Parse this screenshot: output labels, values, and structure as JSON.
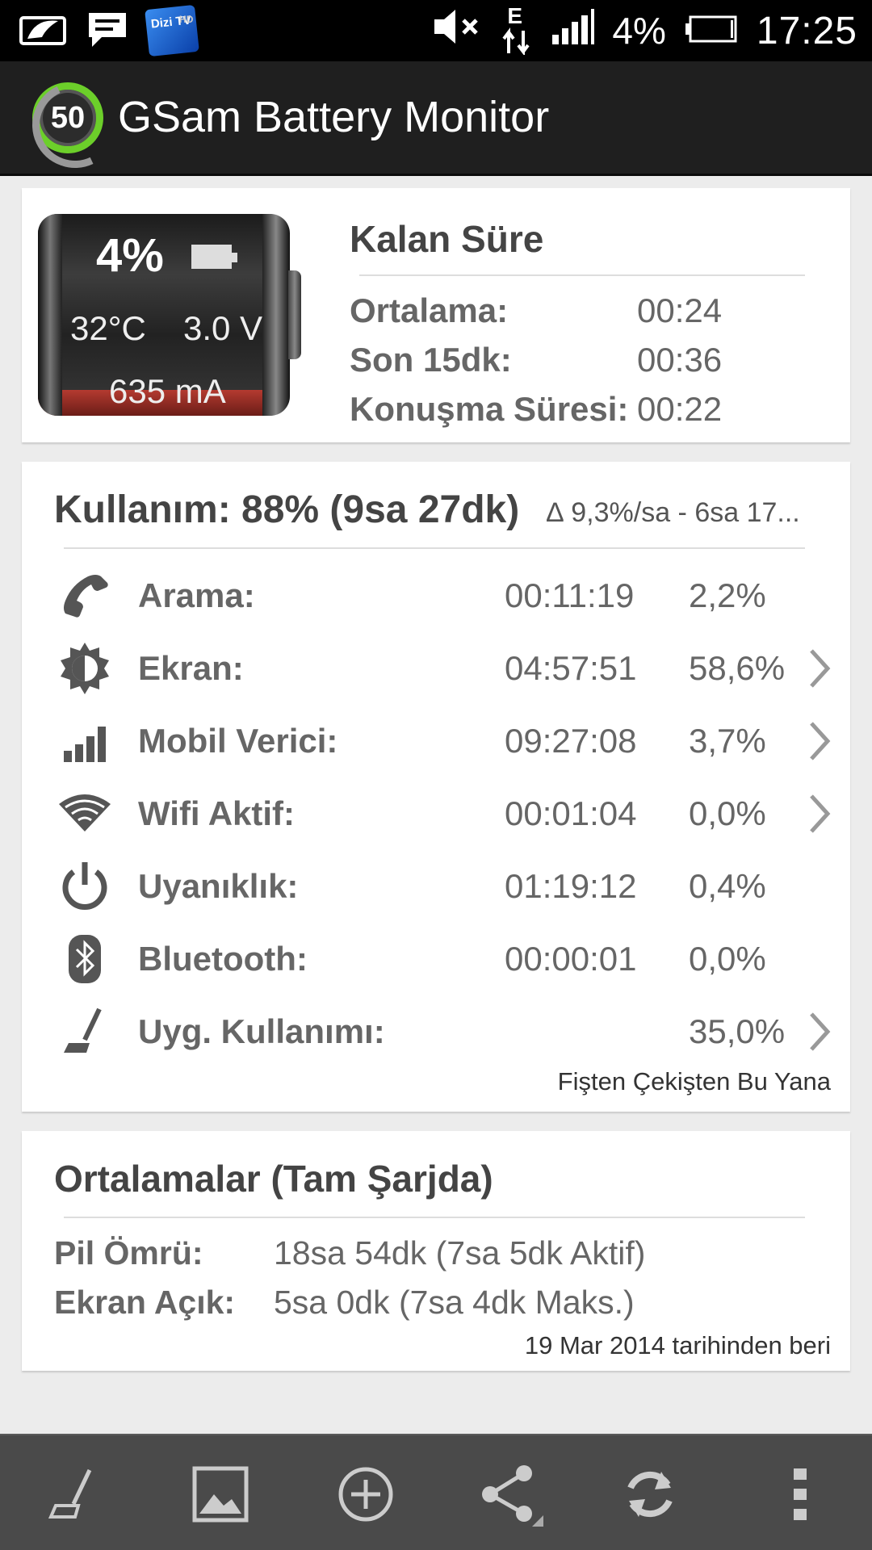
{
  "status_bar": {
    "battery_percent": "4%",
    "time": "17:25",
    "network_type": "E",
    "tv_app": "Dizi TV",
    "tv_hd": "HD"
  },
  "app": {
    "title": "GSam Battery Monitor",
    "logo_value": "50"
  },
  "battery": {
    "percent": "4%",
    "temperature": "32°C",
    "voltage": "3.0 V",
    "current": "635 mA",
    "level_fraction": 0.04
  },
  "remaining": {
    "title": "Kalan Süre",
    "rows": [
      {
        "label": "Ortalama:",
        "value": "00:24"
      },
      {
        "label": "Son 15dk:",
        "value": "00:36"
      },
      {
        "label": "Konuşma Süresi:",
        "value": "00:22"
      }
    ]
  },
  "usage": {
    "title": "Kullanım: 88% (9sa 27dk)",
    "delta": "∆ 9,3%/sa - 6sa 17...",
    "rows": [
      {
        "icon": "phone-icon",
        "label": "Arama:",
        "time": "00:11:19",
        "percent": "2,2%",
        "has_chevron": false
      },
      {
        "icon": "brightness-icon",
        "label": "Ekran:",
        "time": "04:57:51",
        "percent": "58,6%",
        "has_chevron": true
      },
      {
        "icon": "signal-bars-icon",
        "label": "Mobil Verici:",
        "time": "09:27:08",
        "percent": "3,7%",
        "has_chevron": true
      },
      {
        "icon": "wifi-icon",
        "label": "Wifi Aktif:",
        "time": "00:01:04",
        "percent": "0,0%",
        "has_chevron": true
      },
      {
        "icon": "power-icon",
        "label": "Uyanıklık:",
        "time": "01:19:12",
        "percent": "0,4%",
        "has_chevron": false
      },
      {
        "icon": "bluetooth-icon",
        "label": "Bluetooth:",
        "time": "00:00:01",
        "percent": "0,0%",
        "has_chevron": false
      },
      {
        "icon": "broom-icon",
        "label": "Uyg. Kullanımı:",
        "time": "",
        "percent": "35,0%",
        "has_chevron": true
      }
    ],
    "footer": "Fişten Çekişten Bu Yana"
  },
  "averages": {
    "title": "Ortalamalar (Tam Şarjda)",
    "rows": [
      {
        "label": "Pil Ömrü:",
        "value": "18sa 54dk (7sa 5dk Aktif)"
      },
      {
        "label": "Ekran Açık:",
        "value": "5sa 0dk (7sa 4dk Maks.)"
      }
    ],
    "footer": "19 Mar 2014 tarihinden beri"
  },
  "bottom_bar": {
    "actions": [
      "app-usage-icon",
      "image-icon",
      "add-icon",
      "share-icon",
      "refresh-icon",
      "overflow-menu-icon"
    ]
  },
  "colors": {
    "accent_green": "#6ccf2a",
    "battery_red": "#b43a30",
    "appbar": "#1f1f1f",
    "bottombar": "#4a4a4a"
  }
}
